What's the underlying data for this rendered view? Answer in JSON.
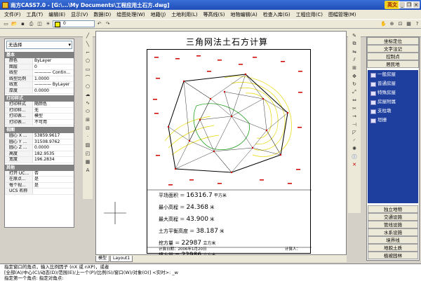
{
  "window": {
    "title": "南方CASS7.0 - [G:\\...\\My Documents\\工程应用土石方.dwg]",
    "logo_text": "英文",
    "minimize": "_",
    "restore": "❐",
    "close": "×"
  },
  "menubar": {
    "items": [
      "文件(F)",
      "工具(T)",
      "编辑(E)",
      "显示(V)",
      "数据(D)",
      "绘图处理(W)",
      "地籍(J)",
      "土地利用(L)",
      "等高线(S)",
      "地物编辑(A)",
      "检查入库(G)",
      "工程应用(C)",
      "图幅管理(M)"
    ]
  },
  "toolbar": {
    "layer_value": "0"
  },
  "properties": {
    "select_value": "无选择",
    "groups": [
      {
        "header": "基本",
        "rows": [
          {
            "k": "颜色",
            "v": "ByLayer"
          },
          {
            "k": "图层",
            "v": "0"
          },
          {
            "k": "线型",
            "v": "———— Contin..."
          },
          {
            "k": "线型比例",
            "v": "1.0000"
          },
          {
            "k": "线宽",
            "v": "———— ByLayer"
          },
          {
            "k": "厚度",
            "v": "0.0000"
          }
        ]
      },
      {
        "header": "打印样式",
        "rows": [
          {
            "k": "打印样式",
            "v": "随颜色"
          },
          {
            "k": "打印样...",
            "v": "无"
          },
          {
            "k": "打印表...",
            "v": "模型"
          },
          {
            "k": "打印表...",
            "v": "不可用"
          }
        ]
      },
      {
        "header": "视图",
        "rows": [
          {
            "k": "圆心 X ...",
            "v": "53859.9617"
          },
          {
            "k": "圆心 Y ...",
            "v": "31508.9762"
          },
          {
            "k": "圆心 Z ...",
            "v": "0.0000"
          },
          {
            "k": "高度",
            "v": "182.9535"
          },
          {
            "k": "宽度",
            "v": "196.2834"
          }
        ]
      },
      {
        "header": "其他",
        "rows": [
          {
            "k": "打开 UC...",
            "v": "否"
          },
          {
            "k": "在原点...",
            "v": "是"
          },
          {
            "k": "每个视...",
            "v": "是"
          },
          {
            "k": "UCS 名称",
            "v": ""
          }
        ]
      }
    ]
  },
  "drawing": {
    "title": "三角网法土石方计算",
    "results": [
      {
        "label": "平场面积",
        "value": "16316.7",
        "unit": "平方米"
      },
      {
        "label": "最小高程",
        "value": "24.368",
        "unit": "米"
      },
      {
        "label": "最大高程",
        "value": "43.900",
        "unit": "米"
      },
      {
        "label": "土方平衡高度",
        "value": "38.187",
        "unit": "米"
      },
      {
        "label": "挖方量",
        "value": "22987",
        "unit": "立方米"
      },
      {
        "label": "填方量",
        "value": "22986",
        "unit": "立方米"
      }
    ],
    "footer_left": "计算日期：2006年1月20日",
    "footer_right": "计算人："
  },
  "model_tabs": [
    "模型",
    "Layout1"
  ],
  "right_panel": {
    "top_items": [
      "坐标定位",
      "文字注记",
      "控制点",
      "居民地"
    ],
    "blue_items": [
      "一般房屋",
      "普通房屋",
      "特殊房屋",
      "房屋附属",
      "支柱墩",
      "垣栅"
    ],
    "bottom_items": [
      "独立地物",
      "交通设施",
      "管线设施",
      "水系设施",
      "境界线",
      "地貌土质",
      "植被园林"
    ]
  },
  "command": {
    "line1": "指定窗口的角点，输入比例因子 (nX 或 nXP)，或者",
    "line2": "[全部(A)/中心(C)/动态(D)/范围(E)/上一个(P)/比例(S)/窗口(W)/对象(O)] <实时>: _w",
    "line3": "指定第一个角点: 指定对角点:"
  }
}
